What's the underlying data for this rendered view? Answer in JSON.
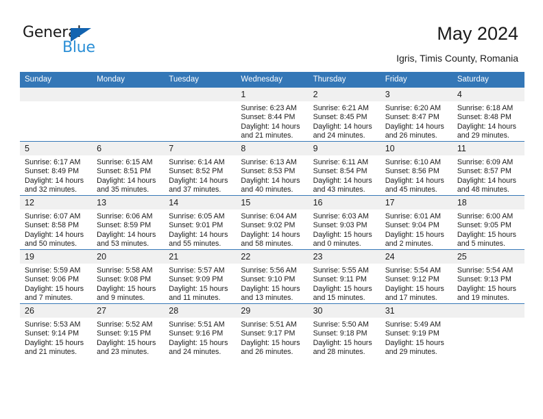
{
  "brand": {
    "name_part1": "General",
    "name_part2": "Blue",
    "primary_color": "#3477b7",
    "accent_color": "#2b8fd6",
    "triangle_color": "#1263b0"
  },
  "header": {
    "title": "May 2024",
    "subtitle": "Igris, Timis County, Romania"
  },
  "weekday_headers": [
    "Sunday",
    "Monday",
    "Tuesday",
    "Wednesday",
    "Thursday",
    "Friday",
    "Saturday"
  ],
  "labels": {
    "sunrise_prefix": "Sunrise: ",
    "sunset_prefix": "Sunset: ",
    "daylight_prefix": "Daylight: "
  },
  "weeks": [
    [
      {
        "day": "",
        "empty": true
      },
      {
        "day": "",
        "empty": true
      },
      {
        "day": "",
        "empty": true
      },
      {
        "day": "1",
        "sunrise": "Sunrise: 6:23 AM",
        "sunset": "Sunset: 8:44 PM",
        "daylight_l1": "Daylight: 14 hours",
        "daylight_l2": "and 21 minutes."
      },
      {
        "day": "2",
        "sunrise": "Sunrise: 6:21 AM",
        "sunset": "Sunset: 8:45 PM",
        "daylight_l1": "Daylight: 14 hours",
        "daylight_l2": "and 24 minutes."
      },
      {
        "day": "3",
        "sunrise": "Sunrise: 6:20 AM",
        "sunset": "Sunset: 8:47 PM",
        "daylight_l1": "Daylight: 14 hours",
        "daylight_l2": "and 26 minutes."
      },
      {
        "day": "4",
        "sunrise": "Sunrise: 6:18 AM",
        "sunset": "Sunset: 8:48 PM",
        "daylight_l1": "Daylight: 14 hours",
        "daylight_l2": "and 29 minutes."
      }
    ],
    [
      {
        "day": "5",
        "sunrise": "Sunrise: 6:17 AM",
        "sunset": "Sunset: 8:49 PM",
        "daylight_l1": "Daylight: 14 hours",
        "daylight_l2": "and 32 minutes."
      },
      {
        "day": "6",
        "sunrise": "Sunrise: 6:15 AM",
        "sunset": "Sunset: 8:51 PM",
        "daylight_l1": "Daylight: 14 hours",
        "daylight_l2": "and 35 minutes."
      },
      {
        "day": "7",
        "sunrise": "Sunrise: 6:14 AM",
        "sunset": "Sunset: 8:52 PM",
        "daylight_l1": "Daylight: 14 hours",
        "daylight_l2": "and 37 minutes."
      },
      {
        "day": "8",
        "sunrise": "Sunrise: 6:13 AM",
        "sunset": "Sunset: 8:53 PM",
        "daylight_l1": "Daylight: 14 hours",
        "daylight_l2": "and 40 minutes."
      },
      {
        "day": "9",
        "sunrise": "Sunrise: 6:11 AM",
        "sunset": "Sunset: 8:54 PM",
        "daylight_l1": "Daylight: 14 hours",
        "daylight_l2": "and 43 minutes."
      },
      {
        "day": "10",
        "sunrise": "Sunrise: 6:10 AM",
        "sunset": "Sunset: 8:56 PM",
        "daylight_l1": "Daylight: 14 hours",
        "daylight_l2": "and 45 minutes."
      },
      {
        "day": "11",
        "sunrise": "Sunrise: 6:09 AM",
        "sunset": "Sunset: 8:57 PM",
        "daylight_l1": "Daylight: 14 hours",
        "daylight_l2": "and 48 minutes."
      }
    ],
    [
      {
        "day": "12",
        "sunrise": "Sunrise: 6:07 AM",
        "sunset": "Sunset: 8:58 PM",
        "daylight_l1": "Daylight: 14 hours",
        "daylight_l2": "and 50 minutes."
      },
      {
        "day": "13",
        "sunrise": "Sunrise: 6:06 AM",
        "sunset": "Sunset: 8:59 PM",
        "daylight_l1": "Daylight: 14 hours",
        "daylight_l2": "and 53 minutes."
      },
      {
        "day": "14",
        "sunrise": "Sunrise: 6:05 AM",
        "sunset": "Sunset: 9:01 PM",
        "daylight_l1": "Daylight: 14 hours",
        "daylight_l2": "and 55 minutes."
      },
      {
        "day": "15",
        "sunrise": "Sunrise: 6:04 AM",
        "sunset": "Sunset: 9:02 PM",
        "daylight_l1": "Daylight: 14 hours",
        "daylight_l2": "and 58 minutes."
      },
      {
        "day": "16",
        "sunrise": "Sunrise: 6:03 AM",
        "sunset": "Sunset: 9:03 PM",
        "daylight_l1": "Daylight: 15 hours",
        "daylight_l2": "and 0 minutes."
      },
      {
        "day": "17",
        "sunrise": "Sunrise: 6:01 AM",
        "sunset": "Sunset: 9:04 PM",
        "daylight_l1": "Daylight: 15 hours",
        "daylight_l2": "and 2 minutes."
      },
      {
        "day": "18",
        "sunrise": "Sunrise: 6:00 AM",
        "sunset": "Sunset: 9:05 PM",
        "daylight_l1": "Daylight: 15 hours",
        "daylight_l2": "and 5 minutes."
      }
    ],
    [
      {
        "day": "19",
        "sunrise": "Sunrise: 5:59 AM",
        "sunset": "Sunset: 9:06 PM",
        "daylight_l1": "Daylight: 15 hours",
        "daylight_l2": "and 7 minutes."
      },
      {
        "day": "20",
        "sunrise": "Sunrise: 5:58 AM",
        "sunset": "Sunset: 9:08 PM",
        "daylight_l1": "Daylight: 15 hours",
        "daylight_l2": "and 9 minutes."
      },
      {
        "day": "21",
        "sunrise": "Sunrise: 5:57 AM",
        "sunset": "Sunset: 9:09 PM",
        "daylight_l1": "Daylight: 15 hours",
        "daylight_l2": "and 11 minutes."
      },
      {
        "day": "22",
        "sunrise": "Sunrise: 5:56 AM",
        "sunset": "Sunset: 9:10 PM",
        "daylight_l1": "Daylight: 15 hours",
        "daylight_l2": "and 13 minutes."
      },
      {
        "day": "23",
        "sunrise": "Sunrise: 5:55 AM",
        "sunset": "Sunset: 9:11 PM",
        "daylight_l1": "Daylight: 15 hours",
        "daylight_l2": "and 15 minutes."
      },
      {
        "day": "24",
        "sunrise": "Sunrise: 5:54 AM",
        "sunset": "Sunset: 9:12 PM",
        "daylight_l1": "Daylight: 15 hours",
        "daylight_l2": "and 17 minutes."
      },
      {
        "day": "25",
        "sunrise": "Sunrise: 5:54 AM",
        "sunset": "Sunset: 9:13 PM",
        "daylight_l1": "Daylight: 15 hours",
        "daylight_l2": "and 19 minutes."
      }
    ],
    [
      {
        "day": "26",
        "sunrise": "Sunrise: 5:53 AM",
        "sunset": "Sunset: 9:14 PM",
        "daylight_l1": "Daylight: 15 hours",
        "daylight_l2": "and 21 minutes."
      },
      {
        "day": "27",
        "sunrise": "Sunrise: 5:52 AM",
        "sunset": "Sunset: 9:15 PM",
        "daylight_l1": "Daylight: 15 hours",
        "daylight_l2": "and 23 minutes."
      },
      {
        "day": "28",
        "sunrise": "Sunrise: 5:51 AM",
        "sunset": "Sunset: 9:16 PM",
        "daylight_l1": "Daylight: 15 hours",
        "daylight_l2": "and 24 minutes."
      },
      {
        "day": "29",
        "sunrise": "Sunrise: 5:51 AM",
        "sunset": "Sunset: 9:17 PM",
        "daylight_l1": "Daylight: 15 hours",
        "daylight_l2": "and 26 minutes."
      },
      {
        "day": "30",
        "sunrise": "Sunrise: 5:50 AM",
        "sunset": "Sunset: 9:18 PM",
        "daylight_l1": "Daylight: 15 hours",
        "daylight_l2": "and 28 minutes."
      },
      {
        "day": "31",
        "sunrise": "Sunrise: 5:49 AM",
        "sunset": "Sunset: 9:19 PM",
        "daylight_l1": "Daylight: 15 hours",
        "daylight_l2": "and 29 minutes."
      },
      {
        "day": "",
        "empty": true
      }
    ]
  ]
}
